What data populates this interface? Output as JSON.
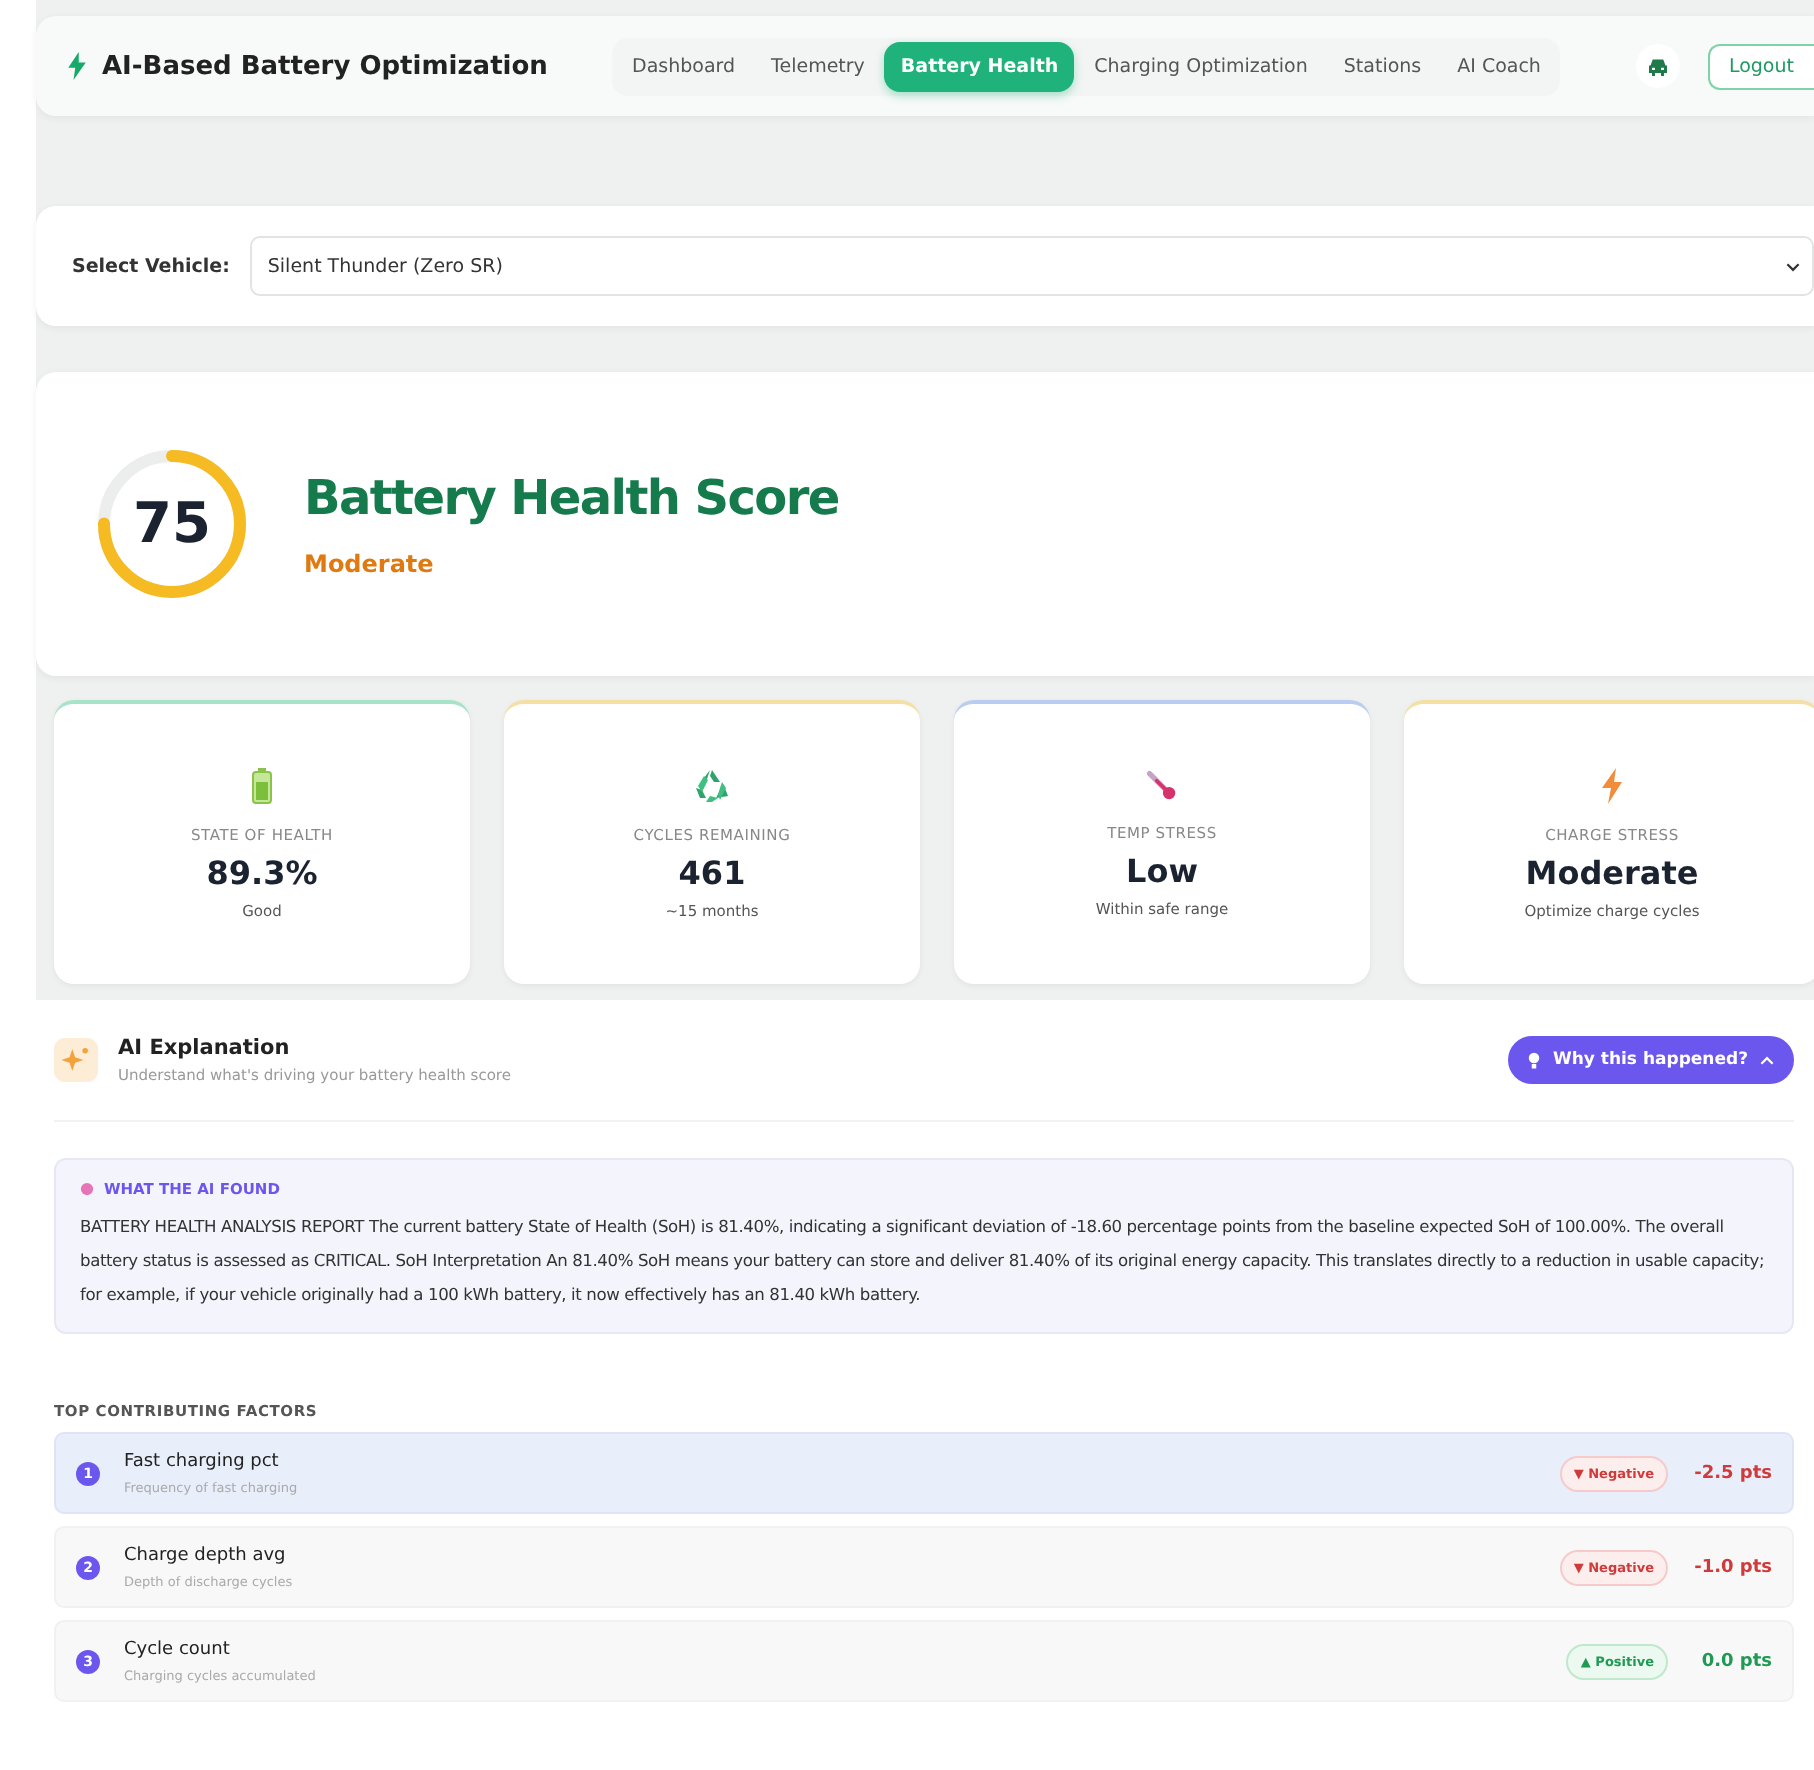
{
  "brand": {
    "title": "AI-Based Battery Optimization"
  },
  "nav": [
    {
      "label": "Dashboard",
      "selected": false
    },
    {
      "label": "Telemetry",
      "selected": false
    },
    {
      "label": "Battery Health",
      "selected": true
    },
    {
      "label": "Charging Optimization",
      "selected": false
    },
    {
      "label": "Stations",
      "selected": false
    },
    {
      "label": "AI Coach",
      "selected": false
    }
  ],
  "logout": "Logout",
  "vehicle": {
    "label": "Select Vehicle:",
    "value": "Silent Thunder (Zero SR)"
  },
  "score": {
    "value": "75",
    "level": 0.75,
    "title": "Battery Health Score",
    "rating": "Moderate"
  },
  "stats": [
    {
      "kind": "battery",
      "color": "#a7e3c9",
      "label": "STATE OF HEALTH",
      "value": "89.3%",
      "note": "Good"
    },
    {
      "kind": "recycle",
      "color": "#f5dfa3",
      "label": "CYCLES REMAINING",
      "value": "461",
      "note": "~15 months"
    },
    {
      "kind": "thermometer",
      "color": "#b9cdf2",
      "label": "TEMP STRESS",
      "value": "Low",
      "note": "Within safe range"
    },
    {
      "kind": "bolt",
      "color": "#f5dfa3",
      "label": "CHARGE STRESS",
      "value": "Moderate",
      "note": "Optimize charge cycles"
    }
  ],
  "explanation": {
    "title": "AI Explanation",
    "subtitle": "Understand what's driving your battery health score",
    "button": "Why this happened?",
    "expanded": true,
    "found_label": "WHAT THE AI FOUND",
    "report": "BATTERY HEALTH ANALYSIS REPORT The current battery State of Health (SoH) is 81.40%, indicating a significant deviation of -18.60 percentage points from the baseline expected SoH of 100.00%. The overall battery status is assessed as CRITICAL. SoH Interpretation An 81.40% SoH means your battery can store and deliver 81.40% of its original energy capacity. This translates directly to a reduction in usable capacity; for example, if your vehicle originally had a 100 kWh battery, it now effectively has an 81.40 kWh battery."
  },
  "factors_title": "TOP CONTRIBUTING FACTORS",
  "factors": [
    {
      "rank": "1",
      "name": "Fast charging pct",
      "desc": "Frequency of fast charging",
      "kind": "negative",
      "badge": "▼ Negative",
      "points": "-2.5 pts",
      "selected": true
    },
    {
      "rank": "2",
      "name": "Charge depth avg",
      "desc": "Depth of discharge cycles",
      "kind": "negative",
      "badge": "▼ Negative",
      "points": "-1.0 pts",
      "selected": false
    },
    {
      "rank": "3",
      "name": "Cycle count",
      "desc": "Charging cycles accumulated",
      "kind": "positive",
      "badge": "▲ Positive",
      "points": "0.0 pts",
      "selected": false
    }
  ]
}
